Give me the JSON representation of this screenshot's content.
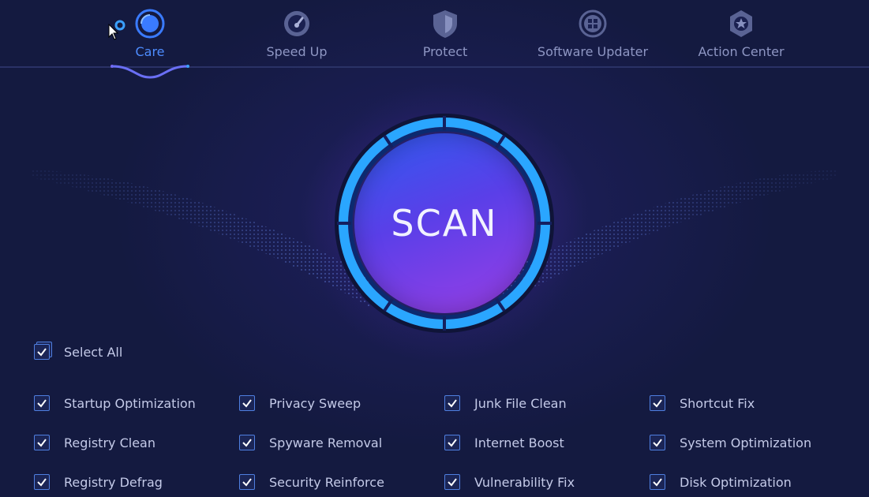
{
  "nav": {
    "tabs": [
      {
        "label": "Care",
        "icon": "care-icon",
        "active": true
      },
      {
        "label": "Speed Up",
        "icon": "speedometer-icon",
        "active": false
      },
      {
        "label": "Protect",
        "icon": "shield-icon",
        "active": false
      },
      {
        "label": "Software Updater",
        "icon": "grid-refresh-icon",
        "active": false
      },
      {
        "label": "Action Center",
        "icon": "gear-star-icon",
        "active": false
      }
    ]
  },
  "scan": {
    "label": "SCAN"
  },
  "options": {
    "select_all": {
      "label": "Select All",
      "checked": true
    },
    "items": [
      {
        "label": "Startup Optimization",
        "checked": true
      },
      {
        "label": "Privacy Sweep",
        "checked": true
      },
      {
        "label": "Junk File Clean",
        "checked": true
      },
      {
        "label": "Shortcut Fix",
        "checked": true
      },
      {
        "label": "Registry Clean",
        "checked": true
      },
      {
        "label": "Spyware Removal",
        "checked": true
      },
      {
        "label": "Internet Boost",
        "checked": true
      },
      {
        "label": "System Optimization",
        "checked": true
      },
      {
        "label": "Registry Defrag",
        "checked": true
      },
      {
        "label": "Security Reinforce",
        "checked": true
      },
      {
        "label": "Vulnerability Fix",
        "checked": true
      },
      {
        "label": "Disk Optimization",
        "checked": true
      }
    ]
  },
  "colors": {
    "background": "#141a40",
    "accent": "#4d8cff",
    "ring": "#2aa6ff",
    "checkbox_border": "#4f7fe0",
    "tab_inactive": "#8e96c3"
  }
}
